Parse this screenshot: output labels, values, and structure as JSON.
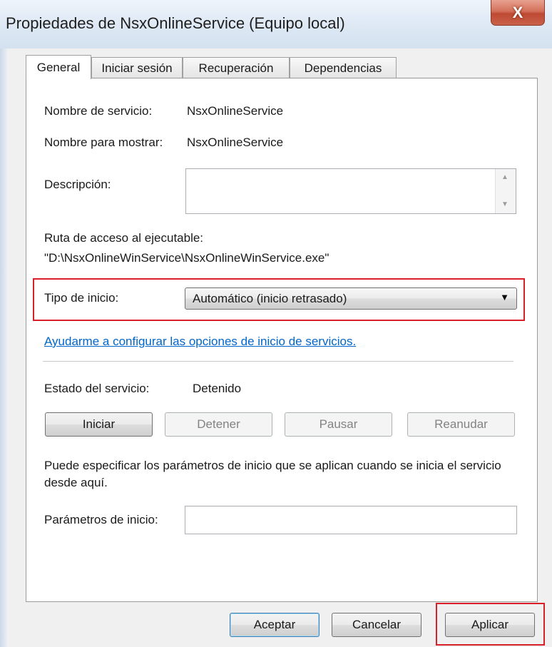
{
  "window": {
    "title": "Propiedades de NsxOnlineService (Equipo local)",
    "close_label": "X"
  },
  "tabs": [
    {
      "label": "General",
      "active": true
    },
    {
      "label": "Iniciar sesión",
      "active": false
    },
    {
      "label": "Recuperación",
      "active": false
    },
    {
      "label": "Dependencias",
      "active": false
    }
  ],
  "general": {
    "service_name_label": "Nombre de servicio:",
    "service_name_value": "NsxOnlineService",
    "display_name_label": "Nombre para mostrar:",
    "display_name_value": "NsxOnlineService",
    "description_label": "Descripción:",
    "description_value": "",
    "exe_path_label": "Ruta de acceso al ejecutable:",
    "exe_path_value": "\"D:\\NsxOnlineWinService\\NsxOnlineWinService.exe\"",
    "startup_type_label": "Tipo de inicio:",
    "startup_type_value": "Automático (inicio retrasado)",
    "help_link": "Ayudarme a configurar las opciones de inicio de servicios.",
    "service_status_label": "Estado del servicio:",
    "service_status_value": "Detenido",
    "buttons": {
      "start": "Iniciar",
      "stop": "Detener",
      "pause": "Pausar",
      "resume": "Reanudar"
    },
    "params_hint": "Puede especificar los parámetros de inicio que se aplican cuando se inicia el servicio desde aquí.",
    "params_label": "Parámetros de inicio:",
    "params_value": ""
  },
  "footer": {
    "ok": "Aceptar",
    "cancel": "Cancelar",
    "apply": "Aplicar"
  },
  "colors": {
    "highlight_border": "#d9202a",
    "link": "#0066cc"
  }
}
